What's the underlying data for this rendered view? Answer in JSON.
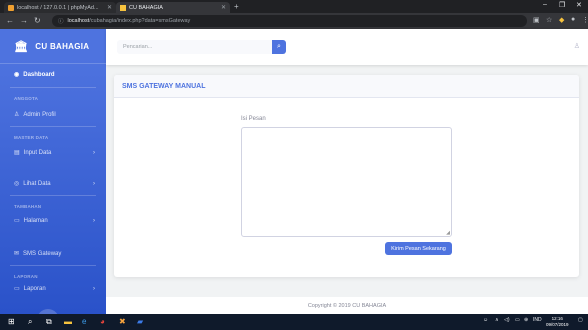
{
  "browser": {
    "tab1_title": "localhost / 127.0.0.1 | phpMyAd...",
    "tab2_title": "CU BAHAGIA",
    "url_host": "localhost",
    "url_path": "/cubahagia/index.php?data=smsGateway"
  },
  "sidebar": {
    "brand": "CU BAHAGIA",
    "dashboard": "Dashboard",
    "head_anggota": "ANGGOTA",
    "admin_profil": "Admin Profil",
    "head_master": "MASTER DATA",
    "input_data": "Input Data",
    "lihat_data": "Lihat Data",
    "head_tambahan": "TAMBAHAN",
    "halaman": "Halaman",
    "sms_gateway": "SMS Gateway",
    "head_laporan": "LAPORAN",
    "laporan": "Laporan"
  },
  "topbar": {
    "search_placeholder": "Pencarian..."
  },
  "card": {
    "title": "SMS GATEWAY MANUAL",
    "label": "Isi Pesan",
    "message_value": "",
    "send_label": "Kirim Pesan Sekarang"
  },
  "footer": {
    "copyright": "Copyright © 2019 CU BAHAGIA"
  },
  "taskbar": {
    "lang": "IND",
    "time": "12:16",
    "date": "09/07/2019"
  }
}
